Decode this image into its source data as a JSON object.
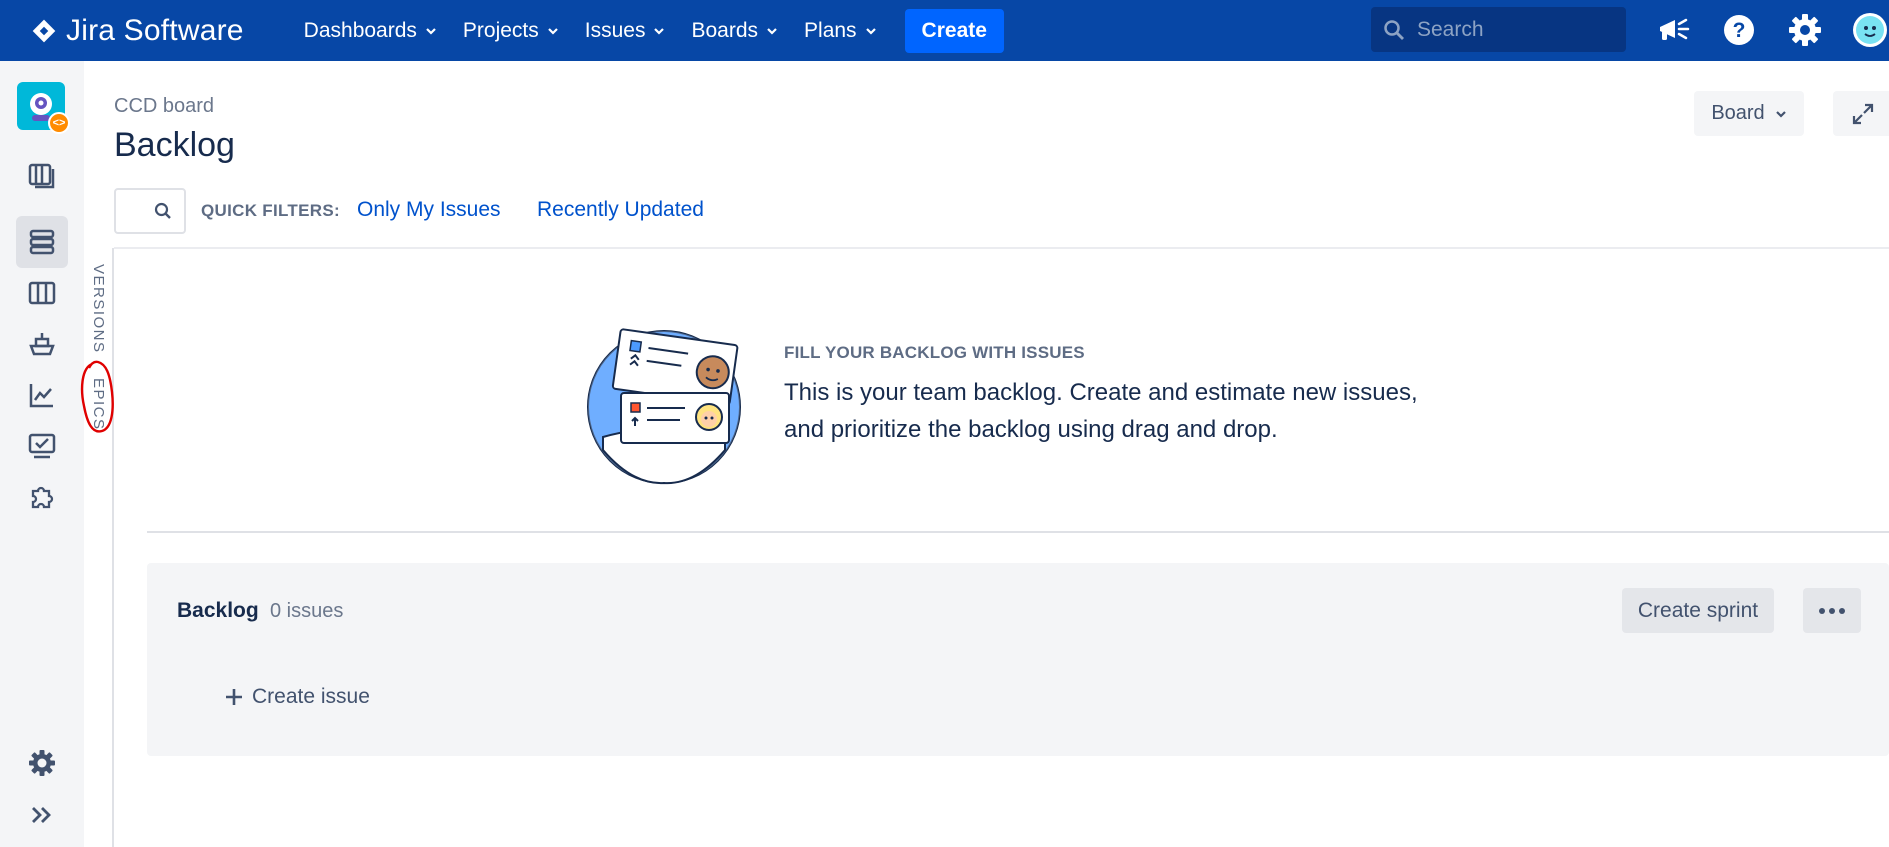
{
  "topnav": {
    "product": "Jira Software",
    "items": [
      {
        "label": "Dashboards"
      },
      {
        "label": "Projects"
      },
      {
        "label": "Issues"
      },
      {
        "label": "Boards"
      },
      {
        "label": "Plans"
      }
    ],
    "create_label": "Create",
    "search_placeholder": "Search",
    "icons": [
      "notifications-megaphone-icon",
      "help-icon",
      "settings-gear-icon",
      "profile-avatar"
    ]
  },
  "rail": {
    "icons": [
      "project-avatar",
      "roadmap-icon",
      "backlog-icon",
      "board-icon",
      "releases-icon",
      "reports-icon",
      "issues-icon",
      "add-ons-icon",
      "settings-icon",
      "expand-sidebar-icon"
    ],
    "active": "backlog-icon"
  },
  "vtabs": {
    "versions": "VERSIONS",
    "epics": "EPICS"
  },
  "header": {
    "breadcrumb": "CCD board",
    "title": "Backlog",
    "board_button": "Board"
  },
  "filters": {
    "label": "QUICK FILTERS:",
    "links": [
      "Only My Issues",
      "Recently Updated"
    ]
  },
  "empty_state": {
    "title": "FILL YOUR BACKLOG WITH ISSUES",
    "body": "This is your team backlog. Create and estimate new issues, and prioritize the backlog using drag and drop."
  },
  "backlog": {
    "title": "Backlog",
    "count": "0 issues",
    "create_sprint": "Create sprint",
    "create_issue": "Create issue"
  },
  "colors": {
    "nav_bg": "#0747a6",
    "create_btn": "#0065ff",
    "link": "#0052cc",
    "annotation": "#e00000"
  }
}
